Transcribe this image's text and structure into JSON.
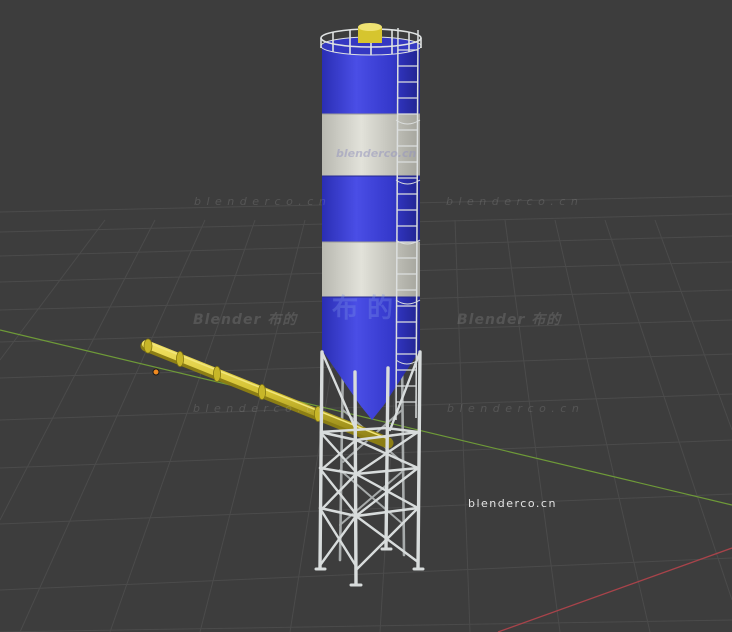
{
  "viewport": {
    "background": "#3d3d3d",
    "grid_color": "#4a4a4a",
    "axis_x_color": "#b44c52",
    "axis_y_color": "#74a03a"
  },
  "scene": {
    "object": "cement-silo",
    "silo_blue": "#3a3ed0",
    "silo_white": "#d8d8d0",
    "frame_color": "#d4d8d8",
    "conveyor_color": "#d4c233"
  },
  "watermarks": {
    "site": "blenderco.cn",
    "site_spaced": "b l e n d e r c o . c n",
    "brand": "Blender 布的",
    "silo_band": "blenderco.cn",
    "silo_glyphs": "布 的"
  }
}
